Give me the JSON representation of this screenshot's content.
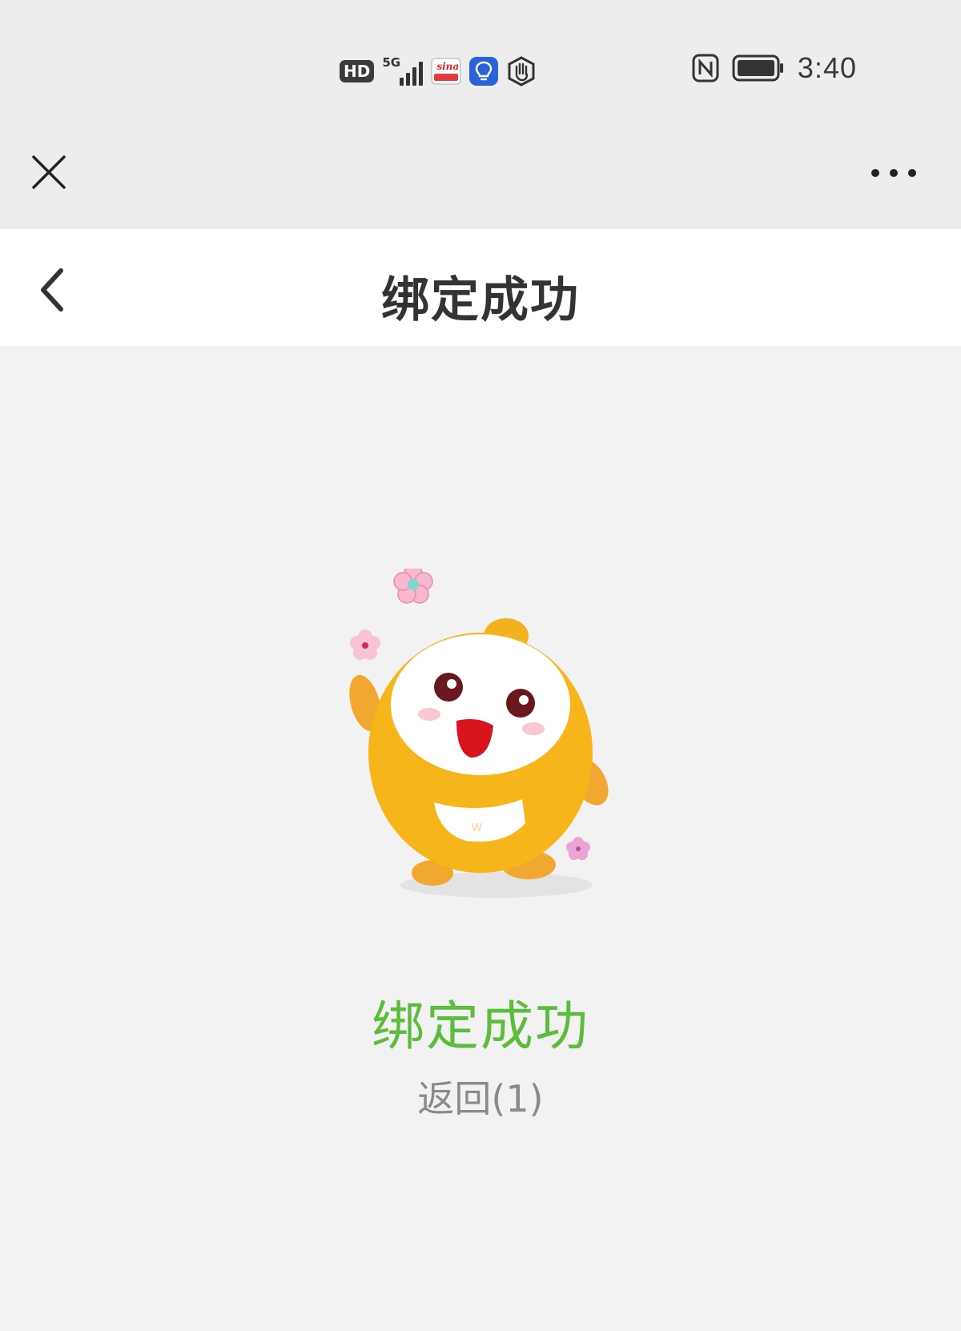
{
  "status_bar": {
    "hd_label": "HD",
    "network_label": "5G",
    "time": "3:40",
    "icons": [
      "hd-icon",
      "signal-5g-icon",
      "sina-app-icon",
      "bulb-app-icon",
      "hand-app-icon",
      "nfc-icon",
      "battery-icon"
    ]
  },
  "wechat_bar": {
    "close_icon": "close-icon",
    "more_icon": "more-dots-icon"
  },
  "header": {
    "title": "绑定成功",
    "back_icon": "chevron-left-icon"
  },
  "main": {
    "illustration": "mascot-waving-illustration",
    "success_message": "绑定成功",
    "back_countdown": "返回(1)"
  },
  "colors": {
    "success_green": "#5cbd3c",
    "mascot_yellow": "#f5b51b",
    "page_bg": "#f2f2f3",
    "header_bg": "#ffffff",
    "bar_bg": "#ededee"
  }
}
